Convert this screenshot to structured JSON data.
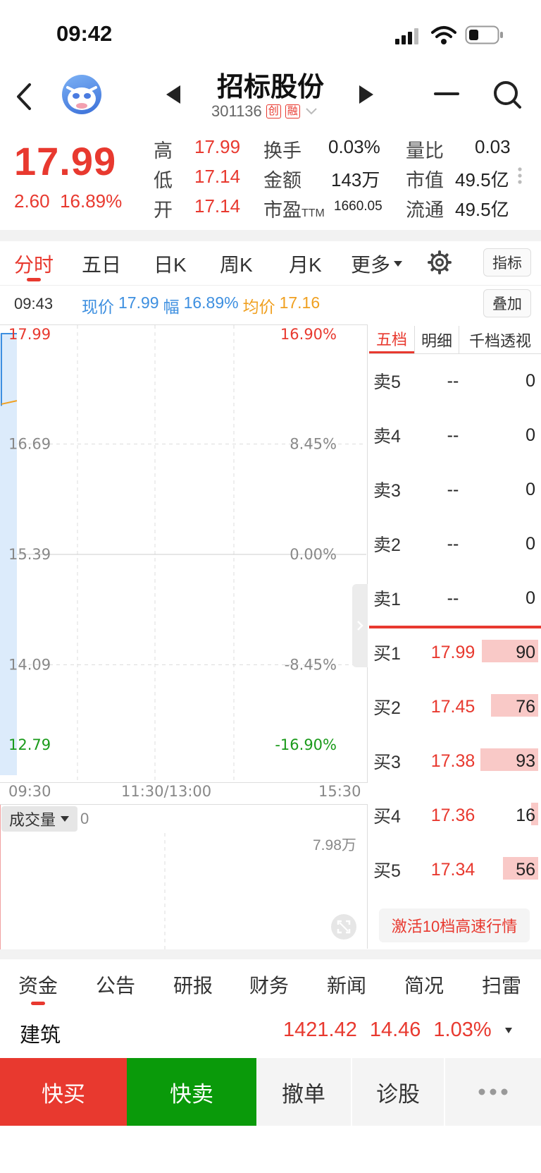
{
  "status_bar": {
    "time": "09:42"
  },
  "header": {
    "title": "招标股份",
    "code": "301136",
    "tags": [
      "创",
      "融"
    ]
  },
  "quote": {
    "price": "17.99",
    "change": "2.60",
    "change_pct": "16.89%",
    "stats": [
      {
        "label": "高",
        "value": "17.99"
      },
      {
        "label": "低",
        "value": "17.14"
      },
      {
        "label": "开",
        "value": "17.14"
      },
      {
        "label": "换手",
        "value": "0.03%"
      },
      {
        "label": "金额",
        "value": "143万"
      },
      {
        "label": "市盈",
        "sub": "TTM",
        "value": "1660.05"
      },
      {
        "label": "量比",
        "value": "0.03"
      },
      {
        "label": "市值",
        "value": "49.5亿"
      },
      {
        "label": "流通",
        "value": "49.5亿"
      }
    ]
  },
  "chart_tabs": [
    "分时",
    "五日",
    "日K",
    "周K",
    "月K",
    "更多"
  ],
  "indicator_label": "指标",
  "overlay_label": "叠加",
  "info_line": {
    "time": "09:43",
    "price_label": "现价",
    "price": "17.99",
    "range_label": "幅",
    "range": "16.89%",
    "avg_label": "均价",
    "avg": "17.16"
  },
  "chart_data": {
    "type": "line",
    "y_left_ticks": [
      "17.99",
      "16.69",
      "15.39",
      "14.09",
      "12.79"
    ],
    "y_right_ticks": [
      "16.90%",
      "8.45%",
      "0.00%",
      "-8.45%",
      "-16.90%"
    ],
    "x_ticks": [
      "09:30",
      "11:30/13:00",
      "15:30"
    ],
    "ylim": [
      12.79,
      17.99
    ],
    "series": [
      {
        "name": "现价",
        "x": [
          "09:30",
          "09:43"
        ],
        "values": [
          17.14,
          17.99
        ],
        "color": "#3d8fe0"
      },
      {
        "name": "均价",
        "x": [
          "09:30",
          "09:43"
        ],
        "values": [
          17.14,
          17.16
        ],
        "color": "#f0a020"
      }
    ]
  },
  "volume": {
    "label": "成交量",
    "value": "0",
    "max_label": "7.98万"
  },
  "orderbook": {
    "tabs": [
      "五档",
      "明细",
      "千档透视"
    ],
    "asks": [
      {
        "label": "卖5",
        "price": "--",
        "vol": "0"
      },
      {
        "label": "卖4",
        "price": "--",
        "vol": "0"
      },
      {
        "label": "卖3",
        "price": "--",
        "vol": "0"
      },
      {
        "label": "卖2",
        "price": "--",
        "vol": "0"
      },
      {
        "label": "卖1",
        "price": "--",
        "vol": "0"
      }
    ],
    "bids": [
      {
        "label": "买1",
        "price": "17.99",
        "vol": "90",
        "bar": 0.8
      },
      {
        "label": "买2",
        "price": "17.45",
        "vol": "76",
        "bar": 0.67
      },
      {
        "label": "买3",
        "price": "17.38",
        "vol": "93",
        "bar": 0.82
      },
      {
        "label": "买4",
        "price": "17.36",
        "vol": "16",
        "bar": 0.1
      },
      {
        "label": "买5",
        "price": "17.34",
        "vol": "56",
        "bar": 0.5
      }
    ],
    "activate_label": "激活10档高速行情"
  },
  "bottom_tabs": [
    "资金",
    "公告",
    "研报",
    "财务",
    "新闻",
    "简况",
    "扫雷"
  ],
  "sector": {
    "name": "建筑",
    "value": "1421.42",
    "change": "14.46",
    "pct": "1.03%"
  },
  "actions": [
    "快买",
    "快卖",
    "撤单",
    "诊股"
  ],
  "colors": {
    "up": "#e8392f",
    "down": "#1a9a1a",
    "buy_button": "#e8392f",
    "sell_button": "#0a9a0a",
    "price_line": "#3d8fe0",
    "avg_line": "#f0a020"
  }
}
